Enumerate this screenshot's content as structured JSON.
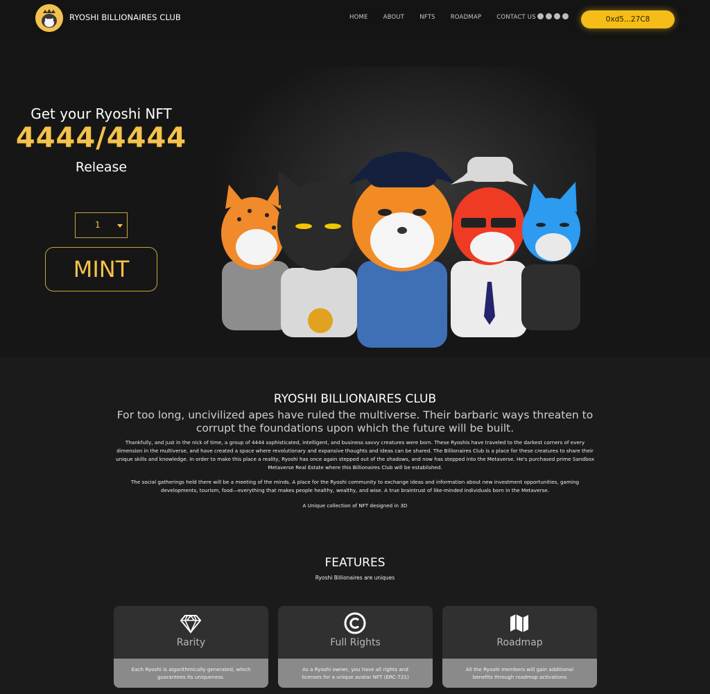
{
  "nav": {
    "brand": "RYOSHI BILLIONAIRES CLUB",
    "menu": [
      "HOME",
      "ABOUT",
      "NFTS",
      "ROADMAP",
      "CONTACT US"
    ],
    "socials": [
      "reddit-icon",
      "discord-icon",
      "twitter-icon",
      "telegram-icon"
    ],
    "wallet": "0xd5...27C8"
  },
  "hero": {
    "heading": "Get your Ryoshi NFT",
    "count": "4444/4444",
    "release": "Release",
    "quantity": "1",
    "mint_label": "MINT"
  },
  "about": {
    "title": "RYOSHI BILLIONAIRES CLUB",
    "subtitle": "For too long, uncivilized apes have ruled the multiverse. Their barbaric ways threaten to corrupt the foundations upon which the future will be built.",
    "p1": "Thankfully, and just in the nick of time, a group of 4444 sophisticated, intelligent, and business savvy creatures were born. These Ryoshis have traveled to the darkest corners of every dimension in the multiverse, and have created a space where revolutionary and expansive thoughts and ideas can be shared. The Billionaires Club is a place for these creatures to share their unique skills and knowledge. In order to make this place a reality, Ryoshi has once again stepped out of the shadows, and now has stepped into the Metaverse. He's purchased prime Sandbox Metaverse Real Estate where this Billionaires Club will be established.",
    "p2": "The social gatherings held there will be a meeting of the minds. A place for the Ryoshi community to exchange ideas and information about new investment opportunities, gaming developments, tourism, food—everything that makes people healthy, wealthy, and wise. A true braintrust of like-minded individuals born in the Metaverse.",
    "p3": "A Unique collection of NFT designed in 3D"
  },
  "features": {
    "title": "FEATURES",
    "subtitle": "Ryoshi Billionaires are uniques",
    "cards": [
      {
        "icon": "diamond-icon",
        "title": "Rarity",
        "text": "Each Ryoshi is algorithmically generated, which guarantees its uniqueness."
      },
      {
        "icon": "copyright-icon",
        "title": "Full Rights",
        "text": "As a Ryoshi owner, you have all rights and licenses for a unique avatar NFT (ERC-721)"
      },
      {
        "icon": "map-icon",
        "title": "Roadmap",
        "text": "All the Ryoshi members will gain additional benefits through roadmap activations"
      }
    ]
  },
  "colors": {
    "accent": "#f5c24b",
    "button": "#f5bd17",
    "background": "#1b1b1b"
  }
}
